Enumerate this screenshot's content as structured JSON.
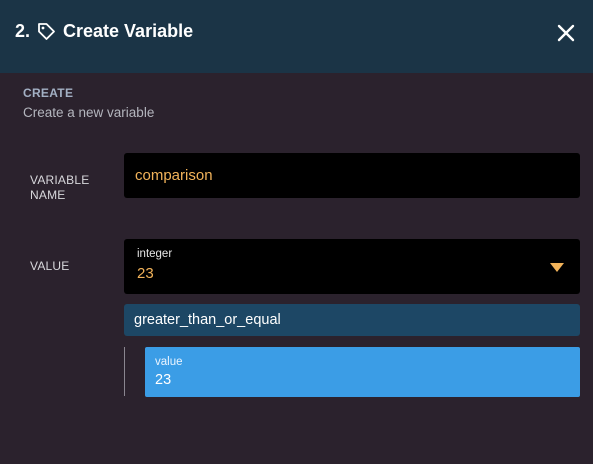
{
  "header": {
    "step": "2.",
    "title": "Create Variable",
    "tag_icon": "tag-icon",
    "close_icon": "close-icon"
  },
  "section": {
    "label": "CREATE",
    "description": "Create a new variable"
  },
  "fields": {
    "variable_name_label": "VARIABLE NAME",
    "variable_name_value": "comparison",
    "value_label": "VALUE"
  },
  "type_select": {
    "label": "integer",
    "value": "23",
    "icon": "chevron-down-icon"
  },
  "operator": {
    "label": "greater_than_or_equal"
  },
  "operand": {
    "label": "value",
    "value": "23"
  },
  "colors": {
    "header_bg": "#1b3446",
    "page_bg": "#2b222d",
    "accent_orange": "#f2b35a",
    "operator_bg": "#1d4765",
    "operand_bg": "#3b9de6"
  }
}
